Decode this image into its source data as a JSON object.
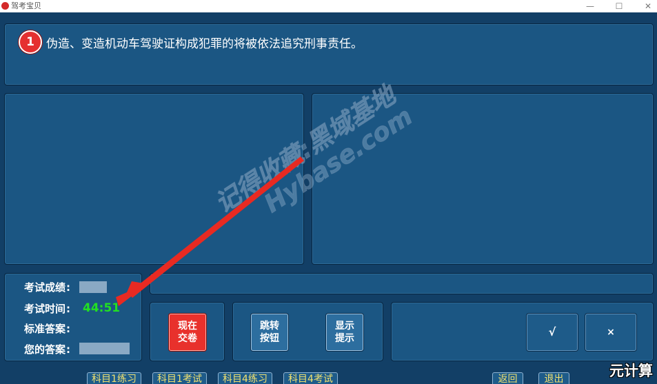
{
  "window": {
    "title": "驾考宝贝",
    "min": "—",
    "max": "☐",
    "close": "✕"
  },
  "question": {
    "number": "1",
    "text": "伪造、变造机动车驾驶证构成犯罪的将被依法追究刑事责任。"
  },
  "info": {
    "score_label": "考试成绩",
    "time_label": "考试时间",
    "time_value": "44:51",
    "standard_answer_label": "标准答案",
    "your_answer_label": "您的答案",
    "colon": ":"
  },
  "buttons": {
    "submit_line1": "现在",
    "submit_line2": "交卷",
    "jump_line1": "跳转",
    "jump_line2": "按钮",
    "hint_line1": "显示",
    "hint_line2": "提示",
    "right": "√",
    "wrong": "×"
  },
  "tabs": [
    "科目1练习",
    "科目1考试",
    "科目4练习",
    "科目4考试",
    "返回",
    "退出"
  ],
  "watermark": {
    "line1": "记得收藏:黑域基地",
    "line2": "Hybase.com"
  },
  "corner_brand": "元计算",
  "colors": {
    "background": "#123f66",
    "panel": "#1b5683",
    "accent_red": "#e8312c",
    "timer_green": "#22e022",
    "tab_text": "#f0e070"
  }
}
